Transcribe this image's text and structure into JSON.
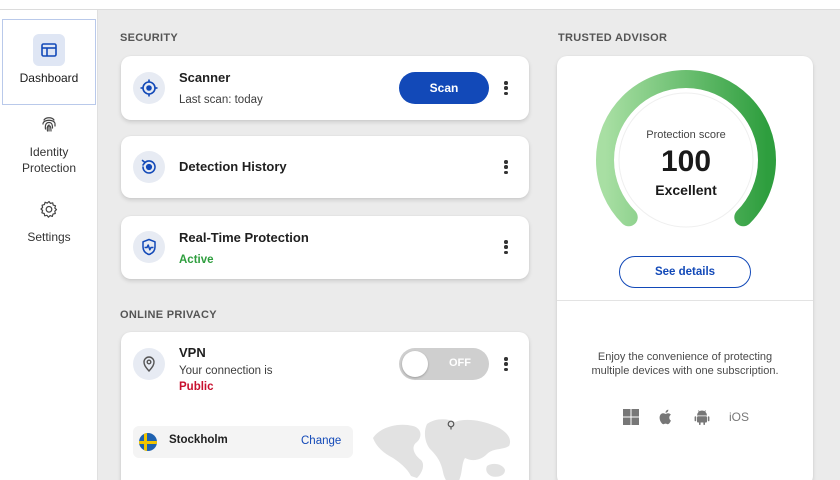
{
  "sidebar": {
    "items": [
      {
        "label": "Dashboard",
        "icon": "dashboard-icon"
      },
      {
        "label": "Identity Protection",
        "icon": "fingerprint-icon"
      },
      {
        "label": "Settings",
        "icon": "gear-icon"
      }
    ]
  },
  "security": {
    "title": "SECURITY",
    "scanner": {
      "title": "Scanner",
      "subtitle": "Last scan: today",
      "button": "Scan",
      "icon": "target-icon"
    },
    "history": {
      "title": "Detection History",
      "icon": "history-icon"
    },
    "realtime": {
      "title": "Real-Time Protection",
      "status": "Active",
      "icon": "shield-pulse-icon"
    }
  },
  "privacy": {
    "title": "ONLINE PRIVACY",
    "vpn": {
      "title": "VPN",
      "subtitle": "Your connection is",
      "status": "Public",
      "toggle_label": "OFF",
      "toggle_on": false,
      "location": "Stockholm",
      "change_label": "Change",
      "icon": "location-pin-icon"
    }
  },
  "advisor": {
    "title": "TRUSTED ADVISOR",
    "score_label": "Protection score",
    "score": "100",
    "score_fraction": 1.0,
    "rating": "Excellent",
    "details_button": "See details",
    "promo": "Enjoy the convenience of protecting multiple devices with one subscription.",
    "platforms": [
      "windows-icon",
      "apple-icon",
      "android-icon"
    ],
    "ios_label": "iOS"
  },
  "colors": {
    "accent": "#1249b8",
    "active": "#2e9e3e",
    "public": "#c8102e",
    "gauge_start": "#a8dfa3",
    "gauge_end": "#2e9e3e"
  }
}
